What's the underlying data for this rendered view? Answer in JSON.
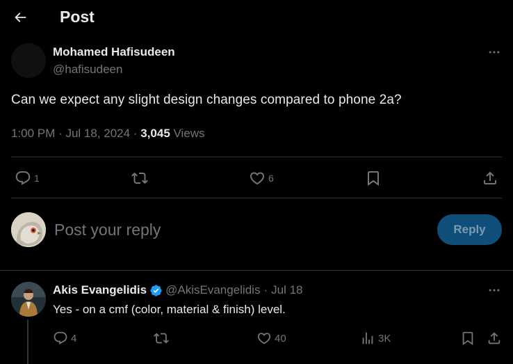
{
  "header": {
    "title": "Post",
    "back_icon": "arrow-left-icon"
  },
  "post": {
    "author_name": "Mohamed Hafisudeen",
    "author_handle": "@hafisudeen",
    "text": "Can we expect any slight design changes compared to phone 2a?",
    "time": "1:00 PM",
    "date": "Jul 18, 2024",
    "separator": "·",
    "views_count": "3,045",
    "views_label": "Views",
    "actions": {
      "reply_count": "1",
      "repost_count": "",
      "like_count": "6"
    }
  },
  "reply_box": {
    "placeholder": "Post your reply",
    "button_label": "Reply"
  },
  "reply": {
    "author_name": "Akis Evangelidis",
    "author_handle": "@AkisEvangelidis",
    "separator": "·",
    "date": "Jul 18",
    "text": "Yes - on a cmf (color, material & finish) level.",
    "actions": {
      "reply_count": "4",
      "repost_count": "",
      "like_count": "40",
      "views_count": "3K"
    }
  },
  "colors": {
    "background": "#000000",
    "text_primary": "#e7e9ea",
    "text_secondary": "#71767b",
    "divider": "#2f3336",
    "reply_button_bg": "#0f4e78",
    "verified": "#1d9bf0"
  }
}
